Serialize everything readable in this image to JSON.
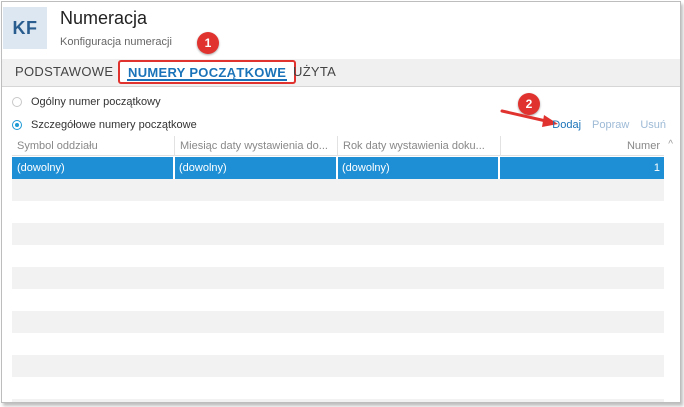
{
  "header": {
    "logo": "KF",
    "title": "Numeracja",
    "subtitle": "Konfiguracja numeracji"
  },
  "annotations": {
    "badge_1": "1",
    "badge_2": "2",
    "accent_color": "#e0332f"
  },
  "tabs": [
    {
      "label": "PODSTAWOWE",
      "active": false
    },
    {
      "label": "NUMERY POCZĄTKOWE",
      "active": true
    },
    {
      "label": "UŻYTA",
      "active": false
    }
  ],
  "radios": [
    {
      "label": "Ogólny numer początkowy",
      "checked": false
    },
    {
      "label": "Szczegółowe numery początkowe",
      "checked": true
    }
  ],
  "actions": {
    "add": "Dodaj",
    "edit": "Popraw",
    "delete": "Usuń"
  },
  "table": {
    "columns": [
      "Symbol oddziału",
      "Miesiąc daty wystawienia do...",
      "Rok daty wystawienia doku...",
      "Numer"
    ],
    "rows": [
      [
        "(dowolny)",
        "(dowolny)",
        "(dowolny)",
        "1"
      ]
    ]
  },
  "colors": {
    "selection": "#1e8fd5",
    "link": "#1a73b8",
    "link_disabled": "#9dbad6"
  }
}
